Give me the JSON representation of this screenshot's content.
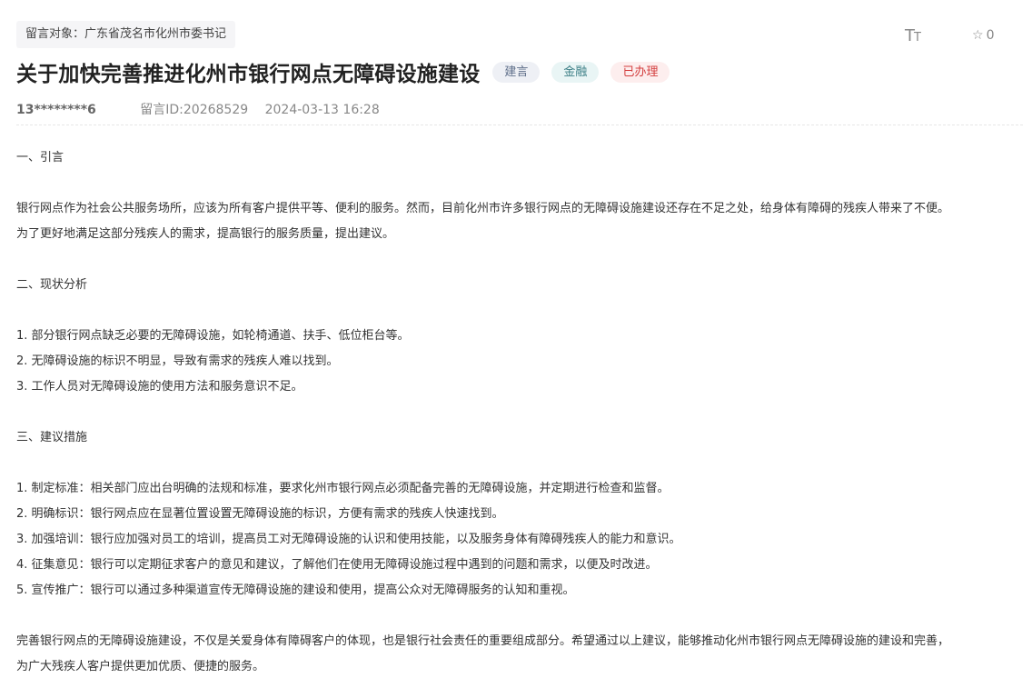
{
  "recipient": "留言对象：广东省茂名市化州市委书记",
  "toolbar": {
    "font_icon_big": "T",
    "font_icon_small": "T",
    "favorite_count": "0"
  },
  "title": "关于加快完善推进化州市银行网点无障碍设施建设",
  "tags": {
    "type": "建言",
    "category": "金融",
    "status": "已办理"
  },
  "meta": {
    "user": "13********6",
    "message_id": "留言ID:20268529",
    "datetime": "2024-03-13 16:28"
  },
  "content": {
    "section1_heading": "一、引言",
    "intro_line1": "银行网点作为社会公共服务场所，应该为所有客户提供平等、便利的服务。然而，目前化州市许多银行网点的无障碍设施建设还存在不足之处，给身体有障碍的残疾人带来了不便。",
    "intro_line2": "为了更好地满足这部分残疾人的需求，提高银行的服务质量，提出建议。",
    "section2_heading": "二、现状分析",
    "status_items": [
      "1. 部分银行网点缺乏必要的无障碍设施，如轮椅通道、扶手、低位柜台等。",
      "2. 无障碍设施的标识不明显，导致有需求的残疾人难以找到。",
      "3. 工作人员对无障碍设施的使用方法和服务意识不足。"
    ],
    "section3_heading": "三、建议措施",
    "suggestion_items": [
      "1. 制定标准：相关部门应出台明确的法规和标准，要求化州市银行网点必须配备完善的无障碍设施，并定期进行检查和监督。",
      "2. 明确标识：银行网点应在显著位置设置无障碍设施的标识，方便有需求的残疾人快速找到。",
      "3. 加强培训：银行应加强对员工的培训，提高员工对无障碍设施的认识和使用技能，以及服务身体有障碍残疾人的能力和意识。",
      "4. 征集意见：银行可以定期征求客户的意见和建议，了解他们在使用无障碍设施过程中遇到的问题和需求，以便及时改进。",
      "5. 宣传推广：银行可以通过多种渠道宣传无障碍设施的建设和使用，提高公众对无障碍服务的认知和重视。"
    ],
    "conclusion_line1": "完善银行网点的无障碍设施建设，不仅是关爱身体有障碍客户的体现，也是银行社会责任的重要组成部分。希望通过以上建议，能够推动化州市银行网点无障碍设施的建设和完善，",
    "conclusion_line2": "为广大残疾人客户提供更加优质、便捷的服务。"
  }
}
